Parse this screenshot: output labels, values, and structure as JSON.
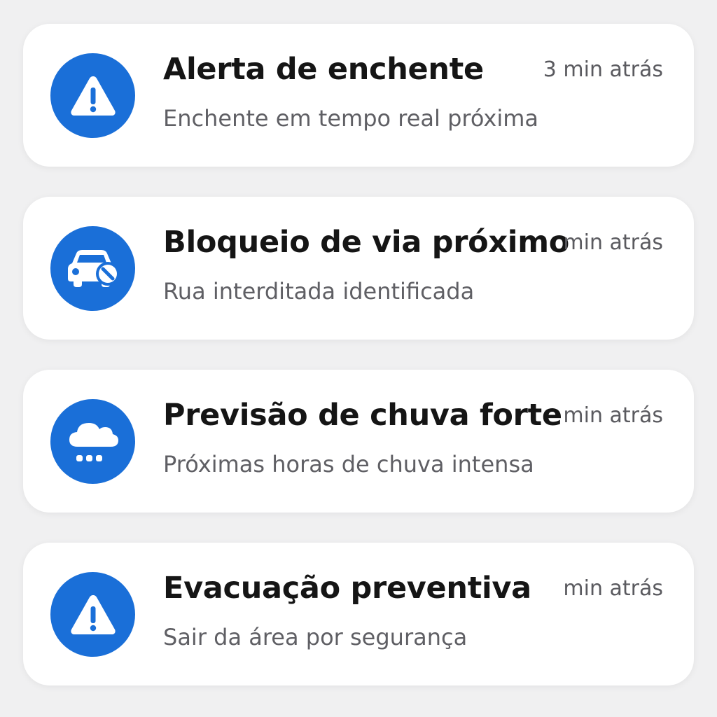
{
  "colors": {
    "icon_background": "#1a6fd8",
    "icon_glyph": "#ffffff",
    "title_text": "#151515",
    "subtitle_text": "#5f5f64",
    "page_background": "#f0f0f1"
  },
  "notifications": [
    {
      "icon": "warning-triangle-icon",
      "title": "Alerta de enchente",
      "time": "3 min atrás",
      "subtitle": "Enchente em tempo real próxima"
    },
    {
      "icon": "car-blocked-icon",
      "title": "Bloqueio de via próximo",
      "time": "min atrás",
      "subtitle": "Rua interditada identificada"
    },
    {
      "icon": "rain-cloud-icon",
      "title": "Previsão de chuva forte",
      "time": "min atrás",
      "subtitle": "Próximas horas de chuva intensa"
    },
    {
      "icon": "warning-triangle-icon",
      "title": "Evacuação preventiva",
      "time": "min atrás",
      "subtitle": "Sair da área por segurança"
    }
  ]
}
